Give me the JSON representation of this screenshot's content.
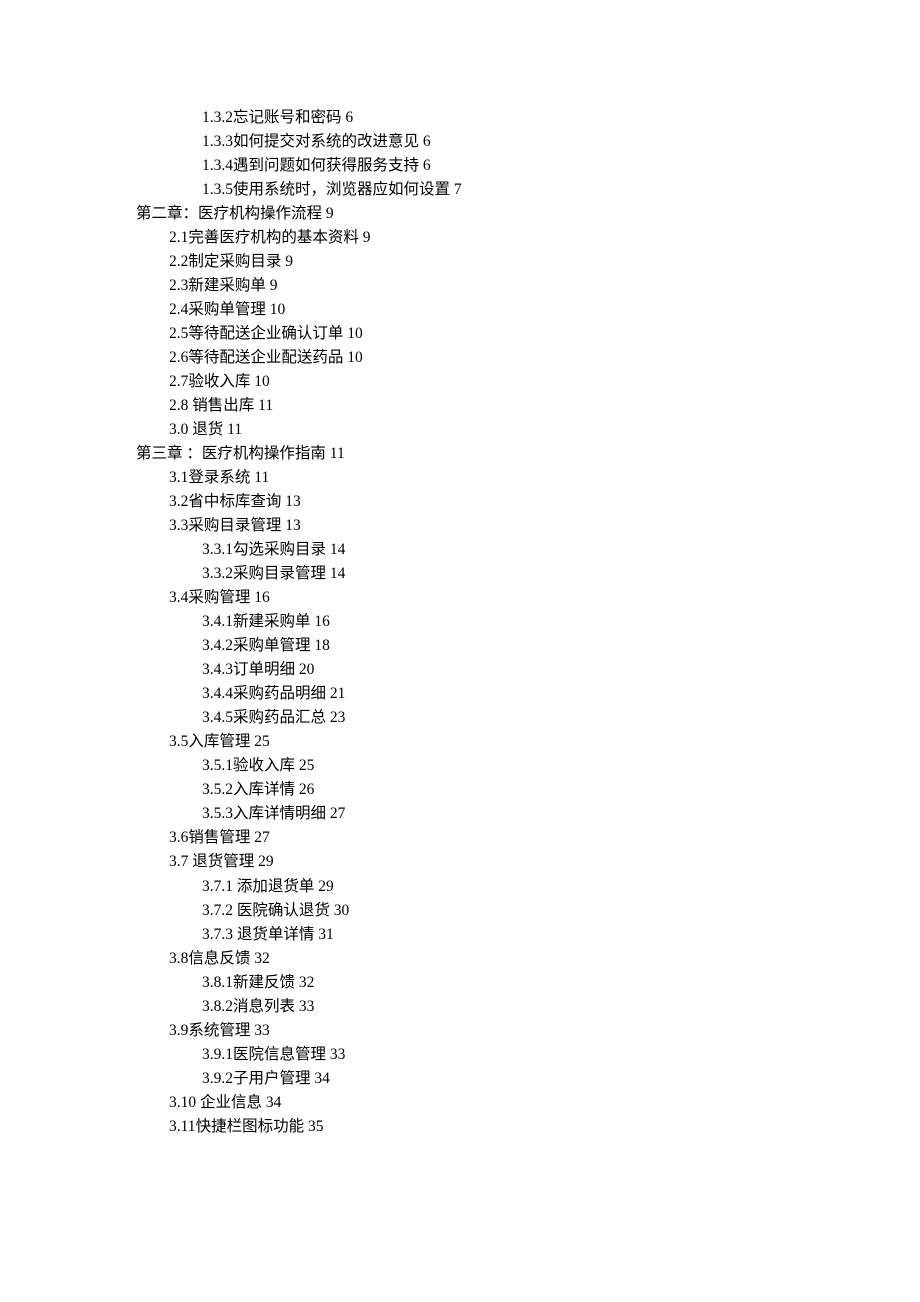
{
  "toc": [
    {
      "level": 2,
      "num": "1.3.2",
      "title": "忘记账号和密码",
      "page": "6"
    },
    {
      "level": 2,
      "num": "1.3.3",
      "title": "如何提交对系统的改进意见",
      "page": "6"
    },
    {
      "level": 2,
      "num": "1.3.4",
      "title": "遇到问题如何获得服务支持",
      "page": "6"
    },
    {
      "level": 2,
      "num": "1.3.5",
      "title": "使用系统时，浏览器应如何设置",
      "page": "7"
    },
    {
      "level": 0,
      "num": "",
      "title": "第二章：医疗机构操作流程",
      "page": "9"
    },
    {
      "level": 1,
      "num": "2.1",
      "title": "完善医疗机构的基本资料",
      "page": "9"
    },
    {
      "level": 1,
      "num": "2.2",
      "title": "制定采购目录",
      "page": "9"
    },
    {
      "level": 1,
      "num": "2.3",
      "title": "新建采购单",
      "page": "9"
    },
    {
      "level": 1,
      "num": "2.4",
      "title": "采购单管理",
      "page": "10"
    },
    {
      "level": 1,
      "num": "2.5",
      "title": "等待配送企业确认订单",
      "page": "10"
    },
    {
      "level": 1,
      "num": "2.6",
      "title": "等待配送企业配送药品",
      "page": "10"
    },
    {
      "level": 1,
      "num": "2.7",
      "title": "验收入库",
      "page": "10"
    },
    {
      "level": 1,
      "num": "2.8 ",
      "title": "销售出库",
      "page": "11"
    },
    {
      "level": 1,
      "num": "3.0 ",
      "title": "退货",
      "page": "11"
    },
    {
      "level": 0,
      "num": "",
      "title": "第三章 ：医疗机构操作指南",
      "page": "11"
    },
    {
      "level": 1,
      "num": "3.1",
      "title": "登录系统",
      "page": "11"
    },
    {
      "level": 1,
      "num": "3.2",
      "title": "省中标库查询",
      "page": "13"
    },
    {
      "level": 1,
      "num": "3.3",
      "title": "采购目录管理",
      "page": "13"
    },
    {
      "level": 2,
      "num": "3.3.1",
      "title": "勾选采购目录",
      "page": "14"
    },
    {
      "level": 2,
      "num": "3.3.2",
      "title": "采购目录管理",
      "page": "14"
    },
    {
      "level": 1,
      "num": "3.4",
      "title": "采购管理",
      "page": "16"
    },
    {
      "level": 2,
      "num": "3.4.1",
      "title": "新建采购单",
      "page": "16"
    },
    {
      "level": 2,
      "num": "3.4.2",
      "title": "采购单管理",
      "page": "18"
    },
    {
      "level": 2,
      "num": "3.4.3",
      "title": "订单明细",
      "page": "20"
    },
    {
      "level": 2,
      "num": "3.4.4",
      "title": "采购药品明细",
      "page": "21"
    },
    {
      "level": 2,
      "num": "3.4.5",
      "title": "采购药品汇总",
      "page": "23"
    },
    {
      "level": 1,
      "num": "3.5",
      "title": "入库管理",
      "page": "25"
    },
    {
      "level": 2,
      "num": "3.5.1",
      "title": "验收入库",
      "page": "25"
    },
    {
      "level": 2,
      "num": "3.5.2",
      "title": "入库详情",
      "page": "26"
    },
    {
      "level": 2,
      "num": "3.5.3",
      "title": "入库详情明细",
      "page": "27"
    },
    {
      "level": 1,
      "num": "3.6",
      "title": "销售管理",
      "page": "27"
    },
    {
      "level": 1,
      "num": "3.7 ",
      "title": "退货管理",
      "page": "29"
    },
    {
      "level": 2,
      "num": "3.7.1 ",
      "title": "添加退货单",
      "page": "29"
    },
    {
      "level": 2,
      "num": "3.7.2 ",
      "title": "医院确认退货",
      "page": "30"
    },
    {
      "level": 2,
      "num": "3.7.3 ",
      "title": "退货单详情",
      "page": "31"
    },
    {
      "level": 1,
      "num": "3.8",
      "title": "信息反馈",
      "page": "32"
    },
    {
      "level": 2,
      "num": "3.8.1",
      "title": "新建反馈",
      "page": "32"
    },
    {
      "level": 2,
      "num": "3.8.2",
      "title": "消息列表",
      "page": "33"
    },
    {
      "level": 1,
      "num": "3.9",
      "title": "系统管理",
      "page": "33"
    },
    {
      "level": 2,
      "num": "3.9.1",
      "title": "医院信息管理",
      "page": "33"
    },
    {
      "level": 2,
      "num": "3.9.2",
      "title": "子用户管理",
      "page": "34"
    },
    {
      "level": 1,
      "num": "3.10 ",
      "title": "企业信息",
      "page": "34"
    },
    {
      "level": 1,
      "num": "3.11",
      "title": "快捷栏图标功能",
      "page": "35"
    }
  ]
}
